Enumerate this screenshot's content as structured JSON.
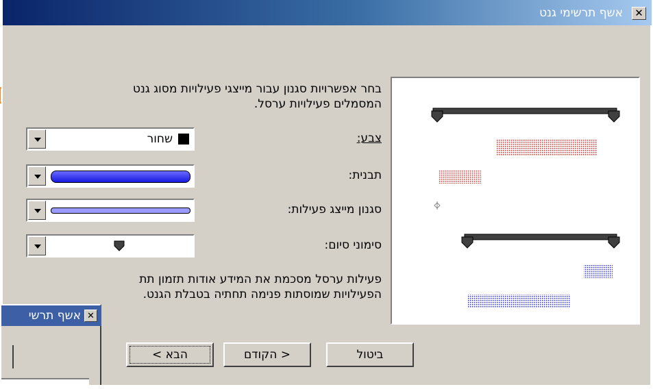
{
  "window": {
    "title": "אשף תרשימי גנט",
    "close": "✕"
  },
  "description": [
    "בחר אפשרויות סגנון עבור מייצגי פעילויות מסוג גנט",
    "המסמלים פעילויות ערסל."
  ],
  "fields": {
    "color": {
      "label": "צבע:",
      "value": "שחור"
    },
    "pattern": {
      "label": "תבנית:"
    },
    "bar_style": {
      "label": "סגנון מייצג פעילות:"
    },
    "end_marks": {
      "label": "סימוני סיום:"
    }
  },
  "summary": [
    "פעילות ערסל מסכמת את המידע אודות תזמון תת",
    "הפעילויות שמוסתות פנימה תחתיה בטבלת הגנט."
  ],
  "buttons": {
    "cancel": "ביטול",
    "back": "< הקודם",
    "next": "הבא >"
  },
  "subwindow": {
    "title": "אשף תרשי",
    "close": "✕"
  },
  "colors": {
    "accent": "#f28c28",
    "bar": "#3333ff",
    "preview_red": "#e03030"
  }
}
